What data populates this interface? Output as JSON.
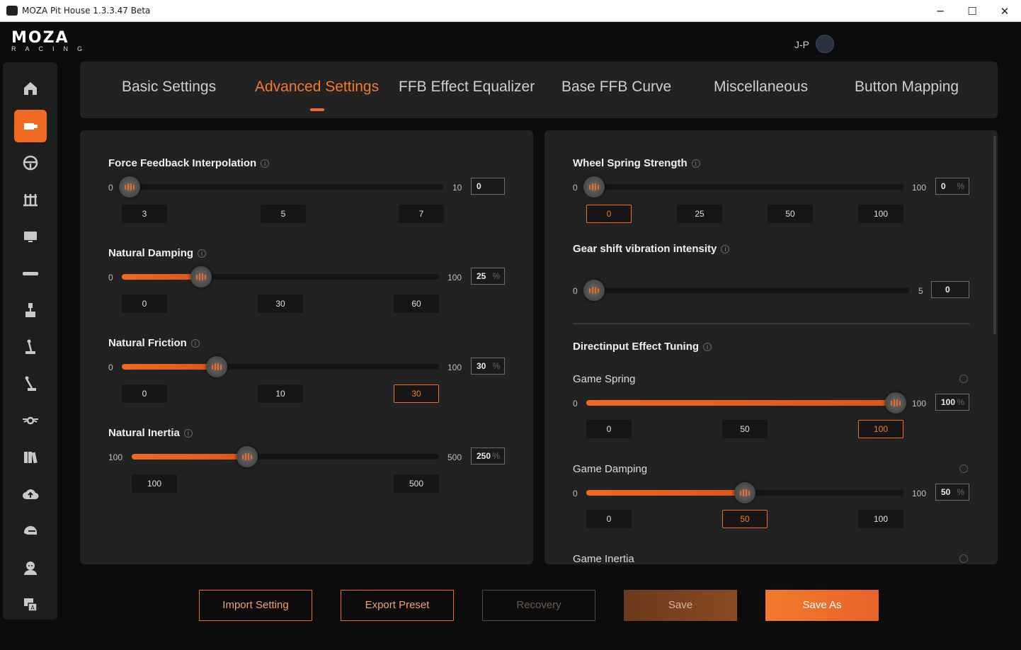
{
  "window": {
    "title": "MOZA Pit House 1.3.3.47 Beta",
    "minimize": "─",
    "maximize": "☐",
    "close": "✕"
  },
  "header": {
    "logo_main": "MOZA",
    "logo_sub": "RACING",
    "user": "J-P"
  },
  "sidebar": {
    "items": [
      {
        "icon": "home-icon"
      },
      {
        "icon": "wheelbase-icon",
        "active": true
      },
      {
        "icon": "steering-wheel-icon"
      },
      {
        "icon": "pedals-icon"
      },
      {
        "icon": "dashboard-icon"
      },
      {
        "icon": "shifter-bar-icon"
      },
      {
        "icon": "handbrake-icon"
      },
      {
        "icon": "sequential-shifter-icon"
      },
      {
        "icon": "hpattern-shifter-icon"
      },
      {
        "icon": "hub-icon"
      },
      {
        "icon": "library-icon"
      },
      {
        "icon": "cloud-icon"
      },
      {
        "icon": "helmet-icon"
      },
      {
        "icon": "user-icon"
      },
      {
        "icon": "language-icon"
      }
    ]
  },
  "tabs": [
    {
      "label": "Basic Settings"
    },
    {
      "label": "Advanced Settings",
      "active": true
    },
    {
      "label": "FFB Effect Equalizer"
    },
    {
      "label": "Base FFB Curve"
    },
    {
      "label": "Miscellaneous"
    },
    {
      "label": "Button Mapping"
    }
  ],
  "left": {
    "ffb_interp": {
      "title": "Force Feedback Interpolation",
      "min": "0",
      "max": "10",
      "value": "0",
      "level": 0.0,
      "presets": [
        "3",
        "5",
        "7"
      ],
      "selected": -1
    },
    "nat_damping": {
      "title": "Natural Damping",
      "min": "0",
      "max": "100",
      "value": "25",
      "unit": "%",
      "level": 0.25,
      "presets": [
        "0",
        "30",
        "60"
      ],
      "selected": -1
    },
    "nat_friction": {
      "title": "Natural Friction",
      "min": "0",
      "max": "100",
      "value": "30",
      "unit": "%",
      "level": 0.3,
      "presets": [
        "0",
        "10",
        "30"
      ],
      "selected": 2
    },
    "nat_inertia": {
      "title": "Natural Inertia",
      "min": "100",
      "max": "500",
      "value": "250",
      "unit": "%",
      "level": 0.375,
      "presets": [
        "100",
        "500"
      ],
      "selected": -1
    }
  },
  "right": {
    "wheel_spring": {
      "title": "Wheel Spring Strength",
      "min": "0",
      "max": "100",
      "value": "0",
      "unit": "%",
      "level": 0.0,
      "presets": [
        "0",
        "25",
        "50",
        "100"
      ],
      "selected": 0
    },
    "gear_vib": {
      "title": "Gear shift vibration intensity",
      "min": "0",
      "max": "5",
      "value": "0",
      "level": 0.0
    },
    "di_title": "Directinput Effect Tuning",
    "game_spring": {
      "title": "Game Spring",
      "min": "0",
      "max": "100",
      "value": "100",
      "unit": "%",
      "level": 1.0,
      "presets": [
        "0",
        "50",
        "100"
      ],
      "selected": 2
    },
    "game_damping": {
      "title": "Game Damping",
      "min": "0",
      "max": "100",
      "value": "50",
      "unit": "%",
      "level": 0.5,
      "presets": [
        "0",
        "50",
        "100"
      ],
      "selected": 1
    },
    "game_inertia": {
      "title": "Game Inertia"
    }
  },
  "buttons": {
    "import": "Import Setting",
    "export": "Export Preset",
    "recovery": "Recovery",
    "save": "Save",
    "save_as": "Save As"
  },
  "colors": {
    "accent": "#f06a23",
    "panel": "#222223",
    "background": "#0c0c0d"
  }
}
